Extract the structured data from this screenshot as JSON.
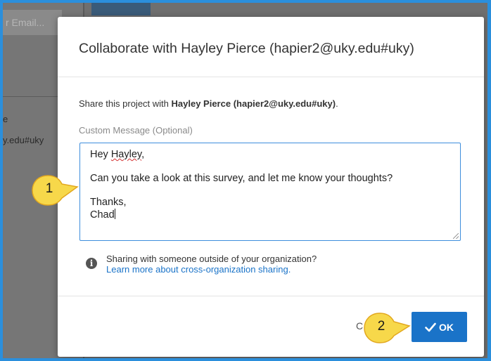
{
  "background": {
    "email_placeholder": "r Email...",
    "partial_text_1": "e",
    "partial_text_2": "y.edu#uky"
  },
  "modal": {
    "title": "Collaborate with Hayley Pierce (hapier2@uky.edu#uky)",
    "share_prefix": "Share this project with ",
    "share_name": "Hayley Pierce (hapier2@uky.edu#uky)",
    "share_suffix": ".",
    "custom_message_label": "Custom Message (Optional)",
    "message": {
      "greeting_prefix": "Hey ",
      "greeting_name": "Hayley",
      "greeting_suffix": ",",
      "body": "Can you take a look at this survey, and let me know your thoughts?",
      "signoff": "Thanks,",
      "signature": "Chad"
    },
    "info_icon": "info-icon",
    "info_text": "Sharing with someone outside of your organization?",
    "info_link": "Learn more about cross-organization sharing.",
    "cancel_label": "C",
    "ok_label": "OK"
  },
  "callouts": [
    {
      "number": "1"
    },
    {
      "number": "2"
    }
  ],
  "colors": {
    "frame": "#2b8fdc",
    "primary": "#1a73c8",
    "callout_fill": "#f7d84a",
    "callout_stroke": "#e2a71e"
  }
}
